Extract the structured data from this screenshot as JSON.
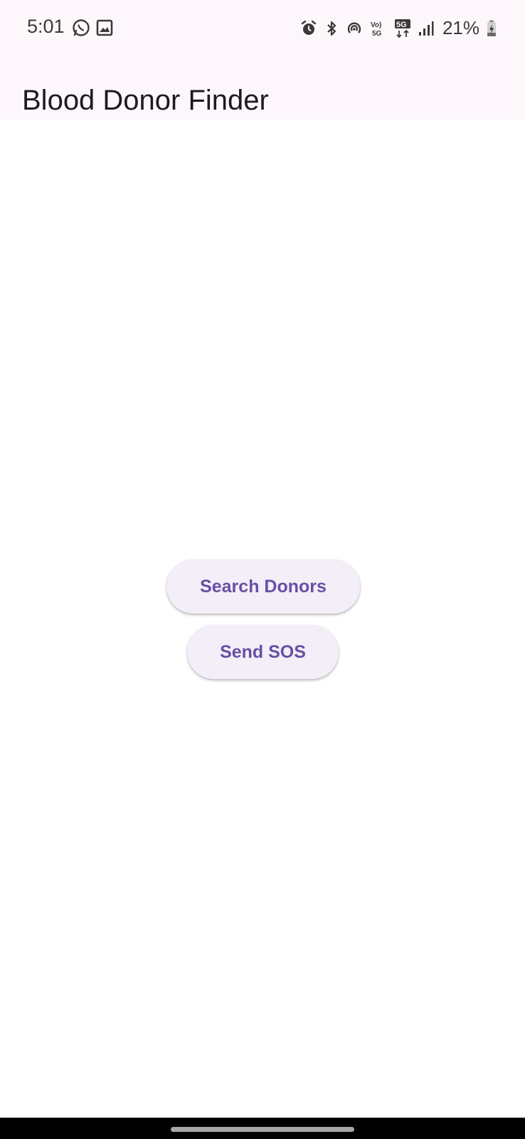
{
  "status_bar": {
    "time": "5:01",
    "left_icons": [
      "whatsapp-icon",
      "gallery-icon"
    ],
    "right_icons": [
      "alarm-icon",
      "bluetooth-icon",
      "hotspot-icon",
      "volte-5g-icon",
      "5g-data-icon",
      "signal-icon"
    ],
    "battery_percent": "21%"
  },
  "app_bar": {
    "title": "Blood Donor Finder"
  },
  "main": {
    "search_button_label": "Search Donors",
    "sos_button_label": "Send SOS"
  },
  "colors": {
    "app_bar_bg": "#fdf7fc",
    "button_bg": "#f3eef7",
    "button_text": "#6750a4"
  }
}
